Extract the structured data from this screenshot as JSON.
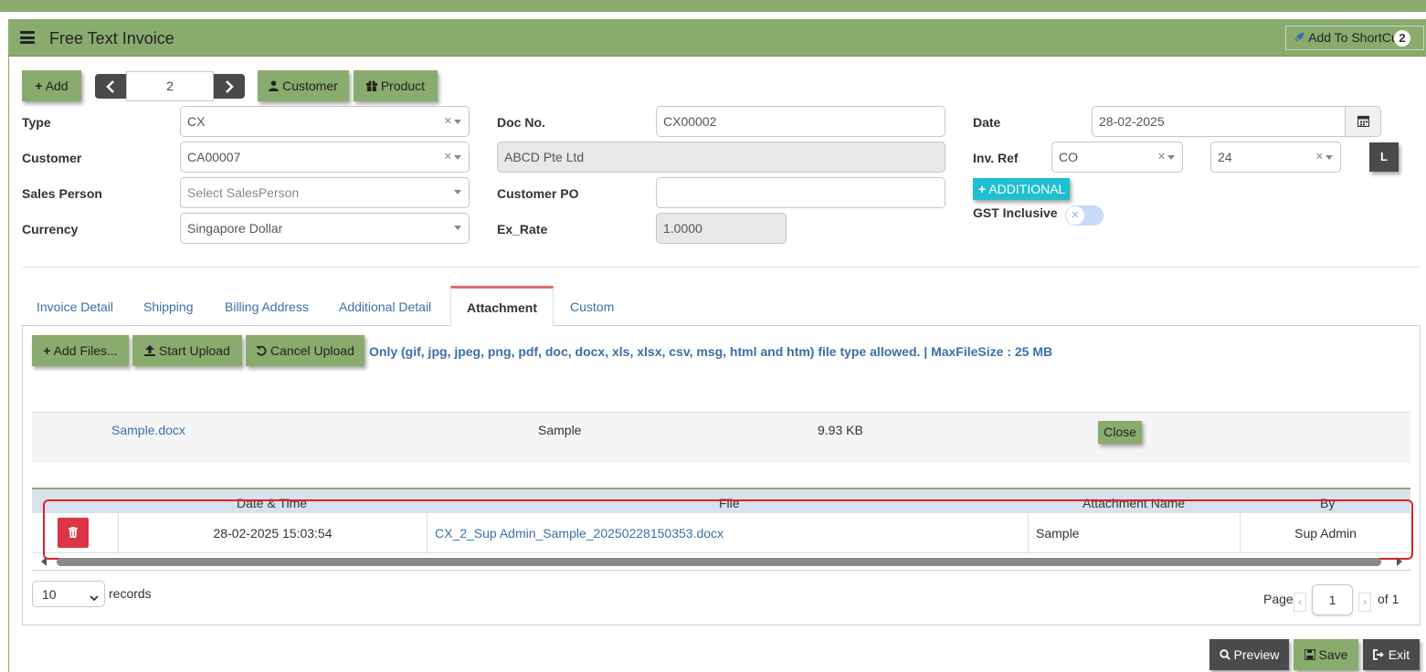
{
  "header": {
    "title": "Free Text Invoice",
    "shortcut_label": "Add To ShortCut",
    "shortcut_count": "2"
  },
  "toolbar": {
    "add_label": "Add",
    "nav_value": "2",
    "customer_label": "Customer",
    "product_label": "Product"
  },
  "form": {
    "type_label": "Type",
    "type_value": "CX",
    "customer_label": "Customer",
    "customer_value": "CA00007",
    "sales_person_label": "Sales Person",
    "sales_person_placeholder": "Select SalesPerson",
    "currency_label": "Currency",
    "currency_value": "Singapore Dollar",
    "doc_no_label": "Doc No.",
    "doc_no_value": "CX00002",
    "customer_name_value": "ABCD Pte Ltd",
    "customer_po_label": "Customer PO",
    "customer_po_value": "",
    "ex_rate_label": "Ex_Rate",
    "ex_rate_value": "1.0000",
    "date_label": "Date",
    "date_value": "28-02-2025",
    "inv_ref_label": "Inv. Ref",
    "inv_ref_prefix": "CO",
    "inv_ref_number": "24",
    "l_button": "L",
    "additional_label": "ADDITIONAL",
    "gst_label": "GST Inclusive"
  },
  "tabs": [
    {
      "label": "Invoice Detail"
    },
    {
      "label": "Shipping"
    },
    {
      "label": "Billing Address"
    },
    {
      "label": "Additional Detail"
    },
    {
      "label": "Attachment"
    },
    {
      "label": "Custom"
    }
  ],
  "attachment": {
    "add_files_label": "Add Files...",
    "start_upload_label": "Start Upload",
    "cancel_upload_label": "Cancel Upload",
    "allowed_text": "Only (gif, jpg, jpeg, png, pdf, doc, docx, xls, xlsx, csv, msg, html and htm) file type allowed. | MaxFileSize : 25 MB",
    "pending_file": {
      "name": "Sample.docx",
      "title": "Sample",
      "size": "9.93 KB",
      "close_label": "Close"
    },
    "table": {
      "headers": [
        "Date & Time",
        "File",
        "Attachment Name",
        "By"
      ],
      "rows": [
        {
          "datetime": "28-02-2025 15:03:54",
          "file": "CX_2_Sup Admin_Sample_20250228150353.docx",
          "name": "Sample",
          "by": "Sup Admin"
        }
      ]
    },
    "records_value": "10",
    "records_label": "records",
    "page_label": "Page",
    "page_value": "1",
    "of_label": "of 1"
  },
  "footer": {
    "preview_label": "Preview",
    "save_label": "Save",
    "exit_label": "Exit"
  }
}
